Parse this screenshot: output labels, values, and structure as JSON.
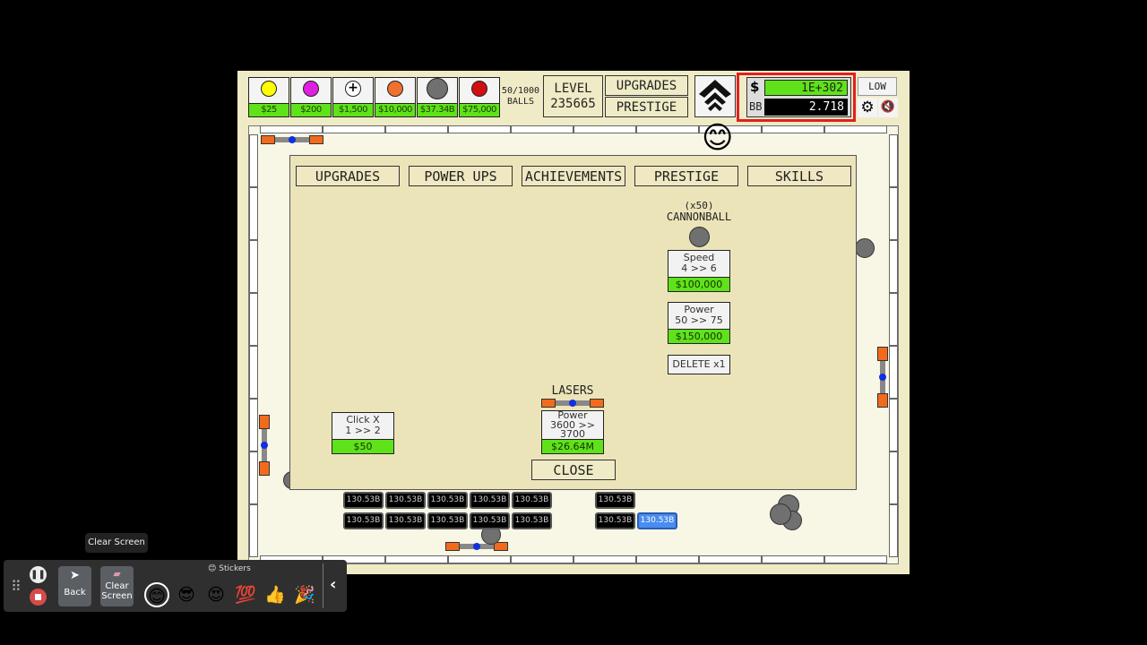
{
  "shop": [
    {
      "name": "yellow-ball",
      "price": "$25",
      "color": "#ffff00"
    },
    {
      "name": "pink-ball",
      "price": "$200",
      "color": "#e020e0"
    },
    {
      "name": "plus-ball",
      "price": "$1,500",
      "color": "#ffffff"
    },
    {
      "name": "orange-ball",
      "price": "$10,000",
      "color": "#f07030"
    },
    {
      "name": "cannon-ball",
      "price": "$37.34B",
      "color": "#707070"
    },
    {
      "name": "nuke-ball",
      "price": "$75,000",
      "color": "#d01010"
    }
  ],
  "balls_count": "50/1000",
  "balls_label": "BALLS",
  "level_label": "LEVEL",
  "level_value": "235665",
  "header_upgrades": "UPGRADES",
  "header_prestige": "PRESTIGE",
  "money_symbol": "$",
  "money_value": "1E+302",
  "bb_label": "BB",
  "bb_value": "2.718",
  "quality": "LOW",
  "tabs": [
    "UPGRADES",
    "POWER UPS",
    "ACHIEVEMENTS",
    "PRESTIGE",
    "SKILLS"
  ],
  "click_card": {
    "line1": "Click  X",
    "line2": "1 >> 2",
    "price": "$50"
  },
  "lasers": {
    "title": "LASERS",
    "line1": "Power",
    "line2": "3600 >>",
    "line3": "3700",
    "price": "$26.64M"
  },
  "cannonball": {
    "count": "(x50)",
    "title": "CANNONBALL",
    "speed": {
      "line1": "Speed",
      "line2": "4 >> 6",
      "price": "$100,000"
    },
    "power": {
      "line1": "Power",
      "line2": "50 >> 75",
      "price": "$150,000"
    },
    "delete": "DELETE x1"
  },
  "close": "CLOSE",
  "bricks": [
    "130.53B",
    "130.53B",
    "130.53B",
    "130.53B",
    "130.53B",
    "130.53B",
    "130.53B",
    "130.53B",
    "130.53B",
    "130.53B",
    "130.53B",
    "130.53B",
    "130.53B"
  ],
  "toolbar": {
    "tooltip": "Clear Screen",
    "back": "Back",
    "clear": "Clear Screen",
    "stickers": "Stickers",
    "stickers_list": [
      "😊",
      "😎",
      "😍",
      "💯",
      "👍",
      "🎉"
    ],
    "sticker_icon": "😊"
  },
  "emoji_floating": "😊"
}
